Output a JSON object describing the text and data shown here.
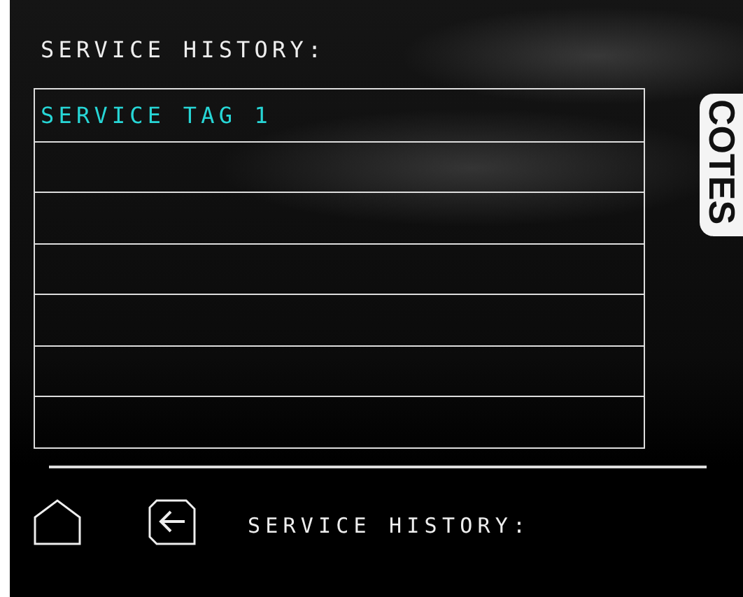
{
  "title": "SERVICE HISTORY:",
  "rows": [
    {
      "label": "SERVICE TAG 1"
    }
  ],
  "brand": "COTES",
  "footer": {
    "title": "SERVICE HISTORY:"
  }
}
